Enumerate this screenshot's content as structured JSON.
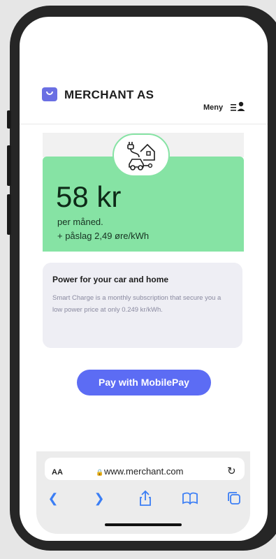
{
  "header": {
    "brand": "MERCHANT AS",
    "menu_label": "Meny"
  },
  "hero": {
    "price": "58 kr",
    "period": "per måned.",
    "addon": "+ påslag 2,49 øre/kWh",
    "accent_color": "#86e3a4"
  },
  "info_card": {
    "title": "Power for your car and home",
    "body": "Smart Charge is a monthly subscription that secure you a low power price at only 0.249 kr/kWh."
  },
  "pay_button": {
    "label": "Pay with MobilePay",
    "color": "#5c6cf4"
  },
  "browser": {
    "aa_label": "AA",
    "url": "www.merchant.com",
    "icons": [
      "back-icon",
      "forward-icon",
      "share-icon",
      "bookmarks-icon",
      "tabs-icon"
    ]
  }
}
